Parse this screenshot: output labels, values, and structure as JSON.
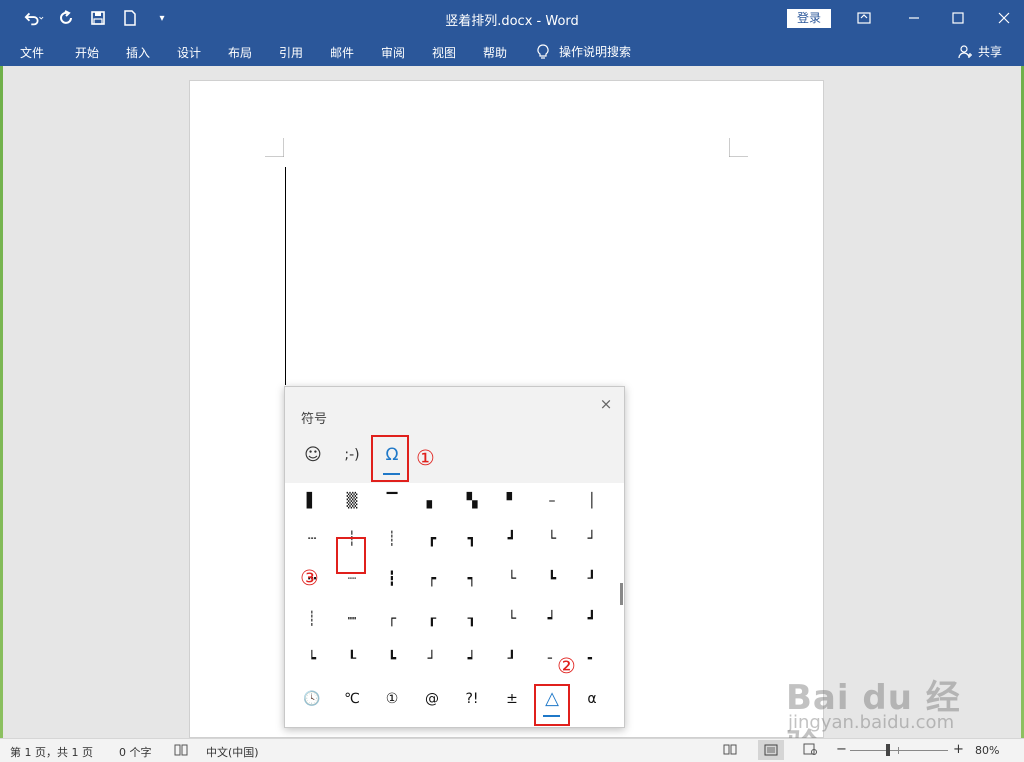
{
  "window": {
    "title": "竖着排列.docx  -  Word",
    "login_label": "登录",
    "qat": {
      "undo": "↶",
      "redo": "↻",
      "save": "💾",
      "new": "🗋",
      "customize": "▾"
    }
  },
  "menu": {
    "items": [
      "文件",
      "开始",
      "插入",
      "设计",
      "布局",
      "引用",
      "邮件",
      "审阅",
      "视图",
      "帮助"
    ],
    "tell_me": "操作说明搜索",
    "share": "共享"
  },
  "symbol_panel": {
    "title": "符号",
    "close": "×",
    "tabs": [
      {
        "label": "☺",
        "icon": "smiley-icon",
        "active": false
      },
      {
        "label": ";-)",
        "icon": "emoticon-icon",
        "active": false
      },
      {
        "label": "Ω",
        "icon": "omega-icon",
        "active": true
      }
    ],
    "grid_rows": [
      [
        "▌",
        "▒",
        "▔",
        "▖",
        "▚",
        "▘",
        "–",
        "│"
      ],
      [
        "┄",
        "┆",
        "┊",
        "┏",
        "┓",
        "┛",
        "└",
        "┘"
      ],
      [
        "┅",
        "┈",
        "┇",
        "┍",
        "┑",
        "└",
        "┗",
        "┚"
      ],
      [
        "┊",
        "┉",
        "┌",
        "┎",
        "┒",
        "└",
        "┙",
        "┛"
      ],
      [
        "┕",
        "┖",
        "┗",
        "┘",
        "┙",
        "┚",
        "╴",
        "╸"
      ]
    ],
    "recent": [
      "🕓",
      "℃",
      "①",
      "@",
      "?!",
      "±",
      "△",
      "α"
    ]
  },
  "annotations": {
    "marker1": "①",
    "marker2": "②",
    "marker3": "③"
  },
  "status": {
    "page": "第 1 页，共 1 页",
    "words": "0 个字",
    "language": "中文(中国)",
    "zoom_minus": "−",
    "zoom_plus": "+",
    "zoom_level": "80%",
    "zoom_fraction": 0.37
  },
  "watermark": {
    "main": "Bai du 经验",
    "sub": "jingyan.baidu.com"
  }
}
